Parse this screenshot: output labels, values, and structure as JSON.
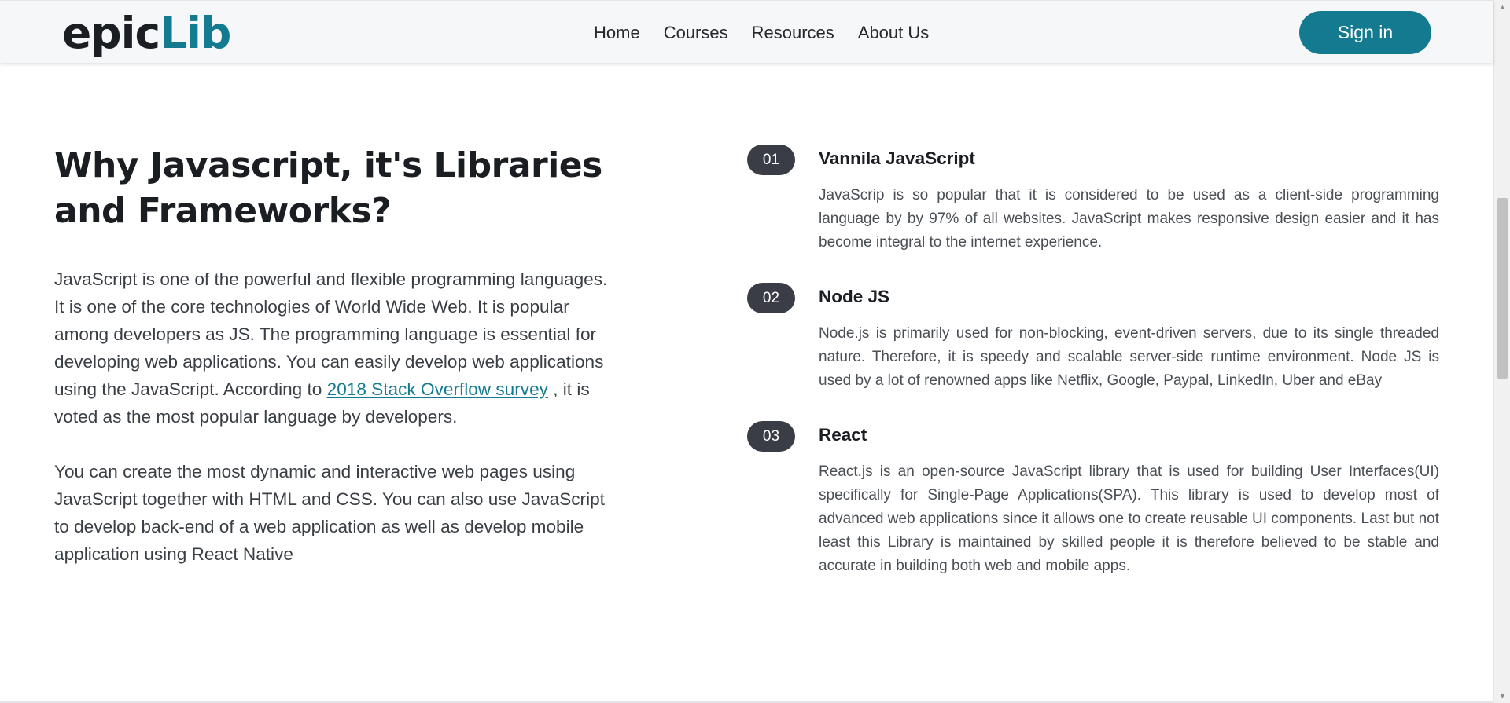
{
  "nav": {
    "brand_part1": "epic",
    "brand_part2": "Lib",
    "links": [
      "Home",
      "Courses",
      "Resources",
      "About Us"
    ],
    "signin_label": "Sign in"
  },
  "intro": {
    "title": "Why Javascript, it's Libraries and Frameworks?",
    "p1_before": "JavaScript is one of the powerful and flexible programming languages. It is one of the core technologies of World Wide Web. It is popular among developers as JS. The programming language is essential for developing web applications. You can easily develop web applications using the JavaScript. According to ",
    "p1_link": "2018 Stack Overflow survey",
    "p1_after": " , it is voted as the most popular language by developers.",
    "p2": "You can create the most dynamic and interactive web pages using JavaScript together with HTML and CSS. You can also use JavaScript to develop back-end of a web application as well as develop mobile application using React Native"
  },
  "features": [
    {
      "number": "01",
      "title": "Vannila JavaScript",
      "text": "JavaScrip is so popular that it is considered to be used as a client-side programming language by by 97% of all websites. JavaScript makes responsive design easier and it has become integral to the internet experience."
    },
    {
      "number": "02",
      "title": "Node JS",
      "text": "Node.js is primarily used for non-blocking, event-driven servers, due to its single threaded nature. Therefore, it is speedy and scalable server-side runtime environment. Node JS is used by a lot of renowned apps like Netflix, Google, Paypal, LinkedIn, Uber and eBay"
    },
    {
      "number": "03",
      "title": "React",
      "text": "React.js is an open-source JavaScript library that is used for building User Interfaces(UI) specifically for Single-Page Applications(SPA). This library is used to develop most of advanced web applications since it allows one to create reusable UI components. Last but not least this Library is maintained by skilled people it is therefore believed to be stable and accurate in building both web and mobile apps."
    }
  ],
  "colors": {
    "brand_teal": "#147a8f",
    "badge_dark": "#3b3d46",
    "navbar_bg": "#f6f7f8"
  }
}
